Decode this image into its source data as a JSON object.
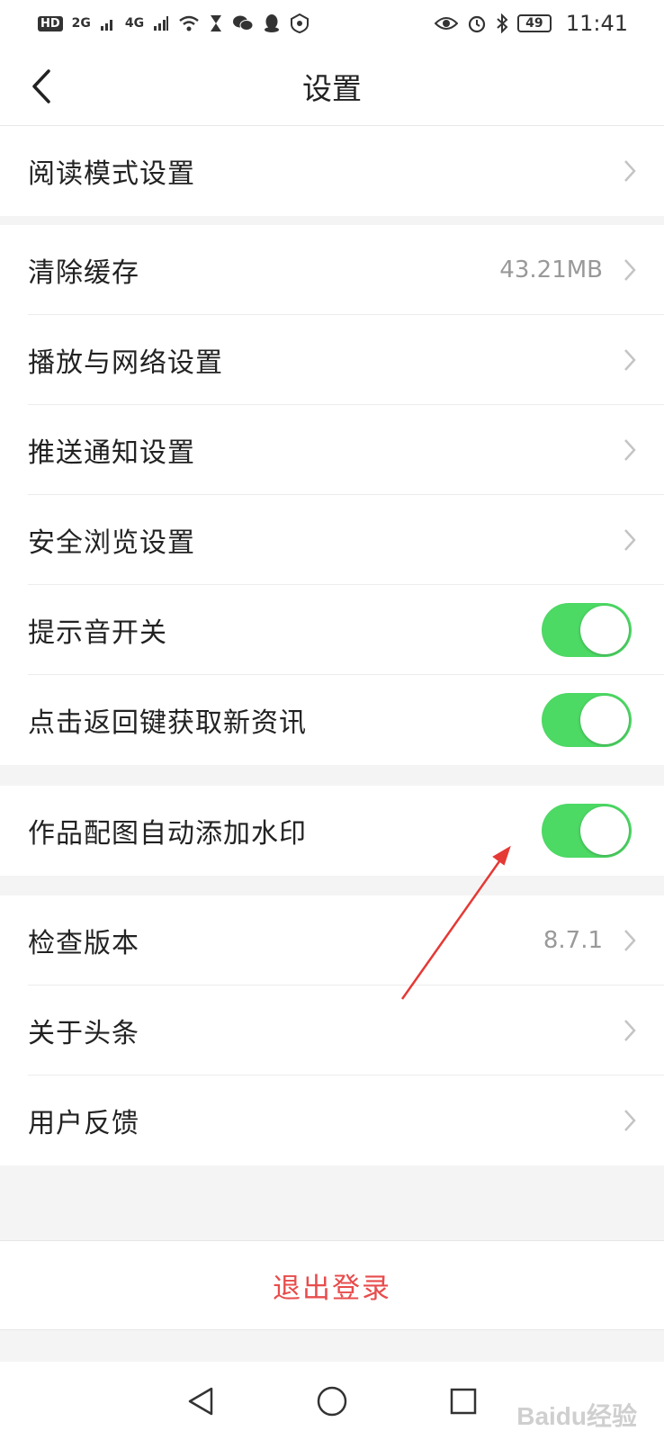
{
  "status_bar": {
    "hd": "HD",
    "sim1": "2G",
    "sim2": "4G",
    "battery": "49",
    "time": "11:41",
    "icons_left": [
      "hd-icon",
      "signal-icon",
      "signal-icon",
      "wifi-icon",
      "hourglass-icon",
      "wechat-icon",
      "qq-icon",
      "shield-icon"
    ],
    "icons_right": [
      "eye-icon",
      "alarm-icon",
      "bluetooth-icon",
      "battery-icon"
    ]
  },
  "header": {
    "title": "设置",
    "back_icon": "chevron-left-icon"
  },
  "groups": [
    {
      "items": [
        {
          "label": "阅读模式设置",
          "type": "link"
        }
      ]
    },
    {
      "items": [
        {
          "label": "清除缓存",
          "value": "43.21MB",
          "type": "link"
        },
        {
          "label": "播放与网络设置",
          "type": "link"
        },
        {
          "label": "推送通知设置",
          "type": "link"
        },
        {
          "label": "安全浏览设置",
          "type": "link"
        },
        {
          "label": "提示音开关",
          "type": "toggle",
          "on": true
        },
        {
          "label": "点击返回键获取新资讯",
          "type": "toggle",
          "on": true
        }
      ]
    },
    {
      "items": [
        {
          "label": "作品配图自动添加水印",
          "type": "toggle",
          "on": true
        }
      ]
    },
    {
      "items": [
        {
          "label": "检查版本",
          "value": "8.7.1",
          "type": "link"
        },
        {
          "label": "关于头条",
          "type": "link"
        },
        {
          "label": "用户反馈",
          "type": "link"
        }
      ]
    }
  ],
  "logout": {
    "label": "退出登录"
  },
  "nav_bar": {
    "icons": [
      "back-triangle-icon",
      "home-circle-icon",
      "recents-square-icon"
    ]
  },
  "colors": {
    "toggle_on": "#4cd964",
    "logout_text": "#e84c4c",
    "annotation_arrow": "#e53935"
  },
  "watermark": "Baidu经验"
}
